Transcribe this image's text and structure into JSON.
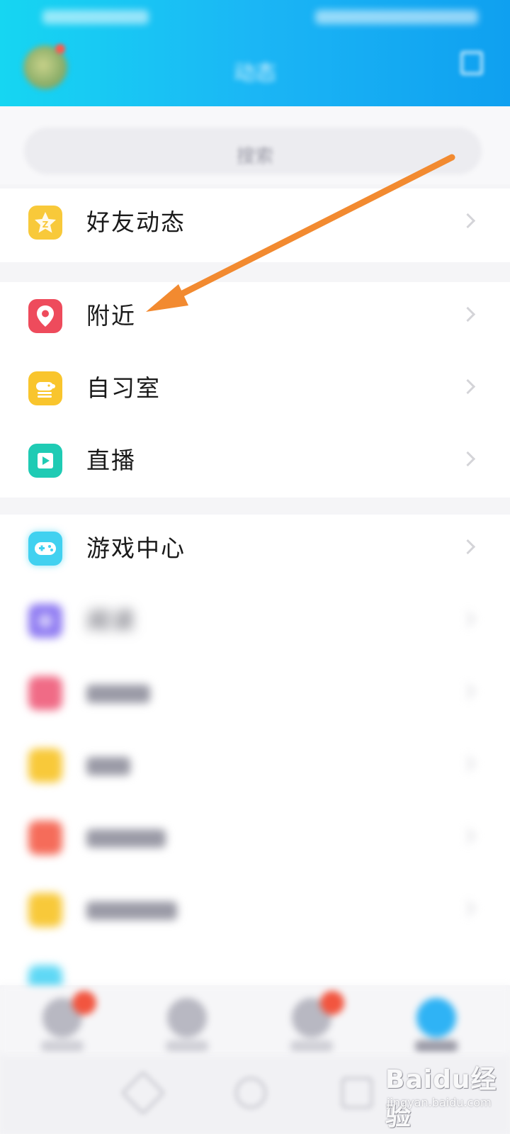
{
  "header": {
    "title": "动态",
    "avatar_icon": "avatar",
    "edit_icon": "edit-icon",
    "background": "#1bb6f5"
  },
  "search": {
    "placeholder": "搜索"
  },
  "groups": [
    {
      "items": [
        {
          "label": "好友动态",
          "icon": "star-icon",
          "color": "#f8c93a"
        }
      ]
    },
    {
      "items": [
        {
          "label": "附近",
          "icon": "location-pin-icon",
          "color": "#ee4b5c"
        },
        {
          "label": "自习室",
          "icon": "study-room-icon",
          "color": "#f9c52d"
        },
        {
          "label": "直播",
          "icon": "live-icon",
          "color": "#1fcbb4"
        }
      ]
    },
    {
      "items": [
        {
          "label": "游戏中心",
          "icon": "gamepad-icon",
          "color": "#41d1f0"
        },
        {
          "label": "阅读",
          "icon": "reading-icon",
          "color": "#8f7bf2"
        },
        {
          "label": "",
          "icon": "app-icon",
          "color": "#f06b86"
        },
        {
          "label": "",
          "icon": "app-icon",
          "color": "#f8c93a"
        },
        {
          "label": "",
          "icon": "app-icon",
          "color": "#f56c5a"
        },
        {
          "label": "",
          "icon": "app-icon",
          "color": "#f8c93a"
        }
      ]
    }
  ],
  "annotation": {
    "arrow_color": "#f28a30",
    "points_to": "附近"
  },
  "watermark": {
    "brand": "Baidu经验",
    "url": "jingyan.baidu.com"
  }
}
